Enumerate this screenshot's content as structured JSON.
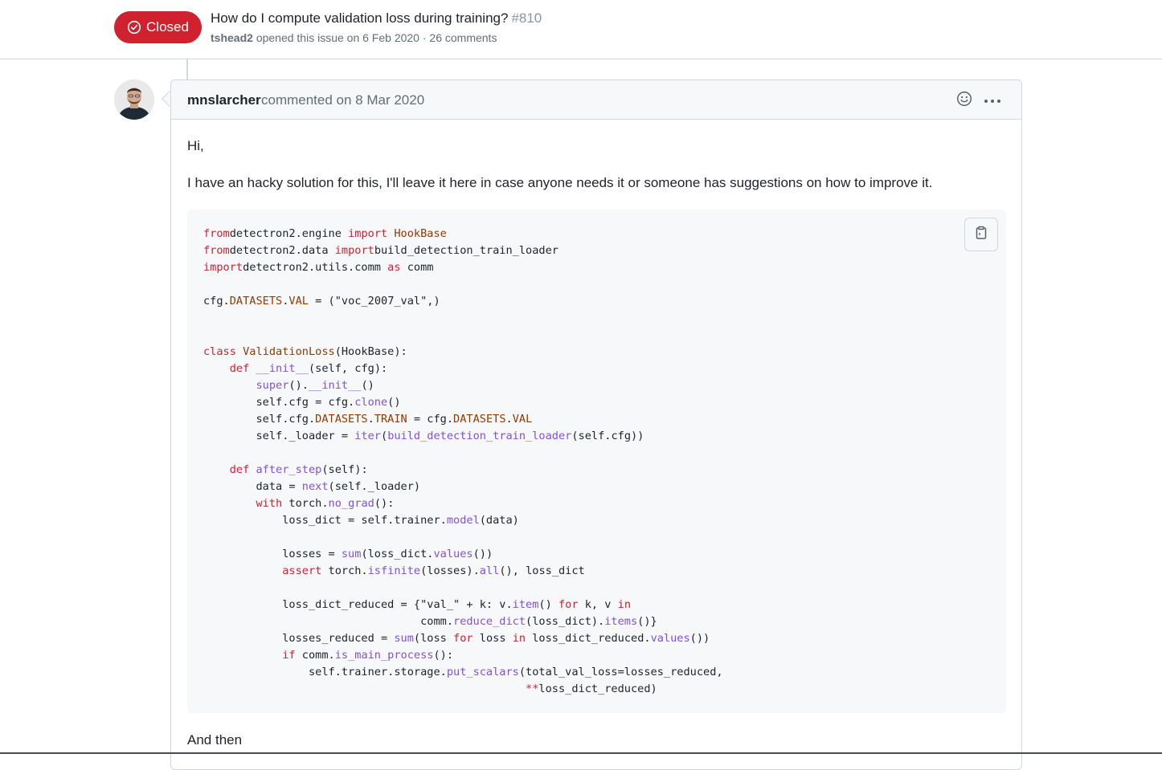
{
  "issue": {
    "state_label": "Closed",
    "title": "How do I compute validation loss during training?",
    "number": "#810",
    "author": "tshead2",
    "meta_text": "opened this issue on 6 Feb 2020 · 26 comments",
    "state_color": "#cf222e"
  },
  "comment": {
    "author": "mnslarcher",
    "action_text": "commented on 8 Mar 2020",
    "paragraphs": {
      "greeting": "Hi,",
      "intro": "I have an hacky solution for this, I'll leave it here in case anyone needs it or someone has suggestions on how to improve it.",
      "after": "And then"
    },
    "icons": {
      "emoji": "smiley-icon",
      "more": "kebab-horizontal-icon",
      "copy": "clipboard-icon",
      "state": "issue-closed-icon"
    },
    "code_lines": [
      [
        [
          "kw",
          "from"
        ],
        [
          "",
          "detectron2.engine "
        ],
        [
          "kw",
          "import"
        ],
        [
          "cl",
          " HookBase"
        ]
      ],
      [
        [
          "kw",
          "from"
        ],
        [
          "",
          "detectron2.data "
        ],
        [
          "kw",
          "import"
        ],
        [
          "",
          ""
        ],
        [
          "",
          ""
        ],
        [
          "",
          "build_detection_train_loader"
        ]
      ],
      [
        [
          "kw",
          "import"
        ],
        [
          "",
          "detectron2.utils.comm "
        ],
        [
          "kw",
          "as"
        ],
        [
          "",
          " comm"
        ]
      ],
      [],
      [
        [
          "",
          "cfg."
        ],
        [
          "cl",
          "DATASETS"
        ],
        [
          "",
          "."
        ],
        [
          "cl",
          "VAL"
        ],
        [
          "",
          " = (\"voc_2007_val\",)"
        ]
      ],
      [],
      [],
      [
        [
          "kw",
          "class"
        ],
        [
          "cl",
          " ValidationLoss"
        ],
        [
          "",
          "(HookBase):"
        ]
      ],
      [
        [
          "",
          "    "
        ],
        [
          "kw",
          "def"
        ],
        [
          "fn",
          " __init__"
        ],
        [
          "",
          "(self, cfg):"
        ]
      ],
      [
        [
          "",
          "        "
        ],
        [
          "fn",
          "super"
        ],
        [
          "",
          "()."
        ],
        [
          "fn",
          "__init__"
        ],
        [
          "",
          "()"
        ]
      ],
      [
        [
          "",
          "        self.cfg = cfg."
        ],
        [
          "fn",
          "clone"
        ],
        [
          "",
          "()"
        ]
      ],
      [
        [
          "",
          "        self.cfg."
        ],
        [
          "cl",
          "DATASETS"
        ],
        [
          "",
          "."
        ],
        [
          "cl",
          "TRAIN"
        ],
        [
          "",
          " = cfg."
        ],
        [
          "cl",
          "DATASETS"
        ],
        [
          "",
          "."
        ],
        [
          "cl",
          "VAL"
        ]
      ],
      [
        [
          "",
          "        self._loader = "
        ],
        [
          "fn",
          "iter"
        ],
        [
          "",
          "("
        ],
        [
          "fn",
          "build_detection_train_loader"
        ],
        [
          "",
          "(self.cfg))"
        ]
      ],
      [],
      [
        [
          "",
          "    "
        ],
        [
          "kw",
          "def"
        ],
        [
          "fn",
          " after_step"
        ],
        [
          "",
          "(self):"
        ]
      ],
      [
        [
          "",
          "        data = "
        ],
        [
          "fn",
          "next"
        ],
        [
          "",
          "(self._loader)"
        ]
      ],
      [
        [
          "",
          "        "
        ],
        [
          "kw",
          "with"
        ],
        [
          "",
          " torch."
        ],
        [
          "fn",
          "no_grad"
        ],
        [
          "",
          "():"
        ]
      ],
      [
        [
          "",
          "            loss_dict = self.trainer."
        ],
        [
          "fn",
          "model"
        ],
        [
          "",
          "(data)"
        ]
      ],
      [],
      [
        [
          "",
          "            losses = "
        ],
        [
          "fn",
          "sum"
        ],
        [
          "",
          "(loss_dict."
        ],
        [
          "fn",
          "values"
        ],
        [
          "",
          "())"
        ]
      ],
      [
        [
          "",
          "            "
        ],
        [
          "kw",
          "assert"
        ],
        [
          "",
          " torch."
        ],
        [
          "fn",
          "isfinite"
        ],
        [
          "",
          "(losses)."
        ],
        [
          "fn",
          "all"
        ],
        [
          "",
          "(), loss_dict"
        ]
      ],
      [],
      [
        [
          "",
          "            loss_dict_reduced = {\"val_\" + k: v."
        ],
        [
          "fn",
          "item"
        ],
        [
          "",
          "() "
        ],
        [
          "kw",
          "for"
        ],
        [
          "",
          " k, v "
        ],
        [
          "kw",
          "in"
        ]
      ],
      [
        [
          "",
          "                                 comm."
        ],
        [
          "fn",
          "reduce_dict"
        ],
        [
          "",
          "(loss_dict)."
        ],
        [
          "fn",
          "items"
        ],
        [
          "",
          "()}"
        ]
      ],
      [
        [
          "",
          "            losses_reduced = "
        ],
        [
          "fn",
          "sum"
        ],
        [
          "",
          "(loss "
        ],
        [
          "kw",
          "for"
        ],
        [
          "",
          " loss "
        ],
        [
          "kw",
          "in"
        ],
        [
          "",
          " loss_dict_reduced."
        ],
        [
          "fn",
          "values"
        ],
        [
          "",
          "())"
        ]
      ],
      [
        [
          "",
          "            "
        ],
        [
          "kw",
          "if"
        ],
        [
          "",
          " comm."
        ],
        [
          "fn",
          "is_main_process"
        ],
        [
          "",
          "():"
        ]
      ],
      [
        [
          "",
          "                self.trainer.storage."
        ],
        [
          "fn",
          "put_scalars"
        ],
        [
          "",
          "(total_val_loss=losses_reduced,"
        ]
      ],
      [
        [
          "",
          "                                                 "
        ],
        [
          "kw",
          "**"
        ],
        [
          "",
          "loss_dict_reduced)"
        ]
      ]
    ]
  }
}
